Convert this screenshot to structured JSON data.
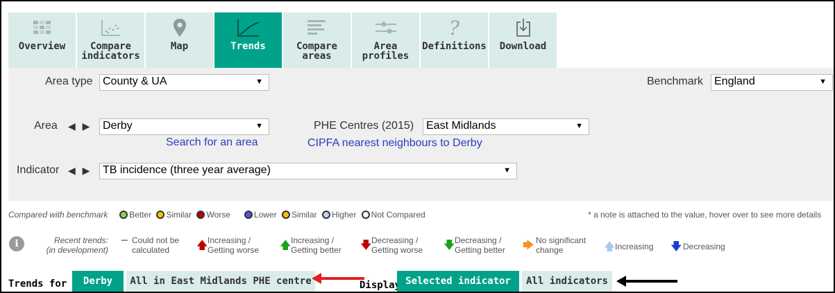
{
  "tabs": [
    {
      "label": "Overview",
      "icon": "overview-grid-icon"
    },
    {
      "label": "Compare\nindicators",
      "icon": "scatter-icon"
    },
    {
      "label": "Map",
      "icon": "map-pin-icon"
    },
    {
      "label": "Trends",
      "icon": "trend-line-icon",
      "active": true
    },
    {
      "label": "Compare\nareas",
      "icon": "bars-icon"
    },
    {
      "label": "Area\nprofiles",
      "icon": "sliders-icon"
    },
    {
      "label": "Definitions",
      "icon": "question-icon"
    },
    {
      "label": "Download",
      "icon": "download-icon"
    }
  ],
  "filters": {
    "area_type_label": "Area type",
    "area_type_value": "County & UA",
    "benchmark_label": "Benchmark",
    "benchmark_value": "England",
    "area_label": "Area",
    "area_value": "Derby",
    "search_link": "Search for an area",
    "phe_label": "PHE Centres (2015)",
    "phe_value": "East Midlands",
    "cipfa_link": "CIPFA nearest neighbours to Derby",
    "indicator_label": "Indicator",
    "indicator_value": "TB incidence (three year average)"
  },
  "legend": {
    "compared_label": "Compared with benchmark",
    "better": "Better",
    "similar": "Similar",
    "worse": "Worse",
    "lower": "Lower",
    "similar2": "Similar",
    "higher": "Higher",
    "not_compared": "Not Compared",
    "note": "* a note is attached to the value, hover over to see more details",
    "colors": {
      "better": "#92d050",
      "similar": "#ffc000",
      "worse": "#c00000",
      "lower": "#5555e6",
      "higher": "#bed2ff",
      "not_compared": "#ffffff"
    }
  },
  "trends": {
    "label": "Recent trends:\n(in development)",
    "items": [
      {
        "label": "Could not be\ncalculated",
        "icon": "dash-icon"
      },
      {
        "label": "Increasing /\nGetting worse",
        "icon": "arrow-up-red-icon"
      },
      {
        "label": "Increasing /\nGetting better",
        "icon": "arrow-up-green-icon"
      },
      {
        "label": "Decreasing /\nGetting worse",
        "icon": "arrow-down-red-icon"
      },
      {
        "label": "Decreasing /\nGetting better",
        "icon": "arrow-down-green-icon"
      },
      {
        "label": "No significant\nchange",
        "icon": "arrow-right-orange-icon"
      },
      {
        "label": "Increasing",
        "icon": "arrow-up-lightblue-icon"
      },
      {
        "label": "Decreasing",
        "icon": "arrow-down-blue-icon"
      }
    ]
  },
  "bottom": {
    "trends_for_label": "Trends for",
    "derby_btn": "Derby",
    "all_btn": "All in East Midlands PHE centre",
    "display_label": "Display",
    "selected_btn": "Selected indicator",
    "all_ind_btn": "All indicators"
  }
}
